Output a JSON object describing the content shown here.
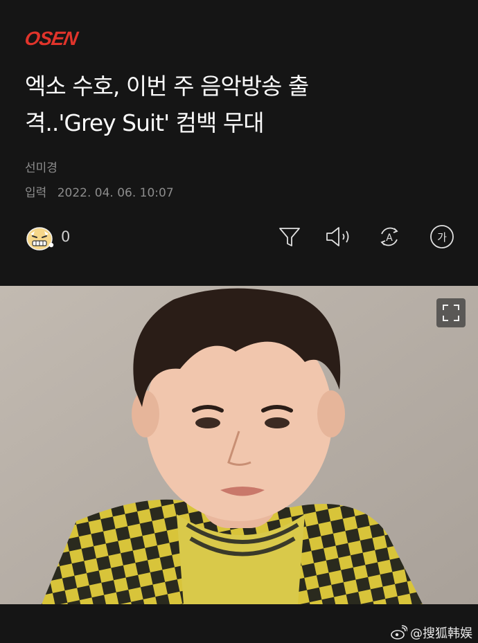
{
  "header": {
    "logo_text": "OSEN",
    "title_line1": "엑소 수호, 이번 주 음악방송 출",
    "title_line2": "격..'Grey Suit' 컴백 무대",
    "author": "선미경",
    "date_label": "입력",
    "date_value": "2022. 04. 06. 10:07"
  },
  "actions": {
    "reaction_count": "0",
    "icons": [
      "filter-icon",
      "speaker-icon",
      "translate-icon",
      "font-size-icon"
    ],
    "font_icon_text": "가",
    "translate_icon_text": "A"
  },
  "photo": {
    "expand_icon": "fullscreen-icon"
  },
  "watermark": {
    "text": "@搜狐韩娱"
  },
  "colors": {
    "background": "#151515",
    "logo": "#e0342b",
    "meta_text": "#8d8d8d"
  }
}
